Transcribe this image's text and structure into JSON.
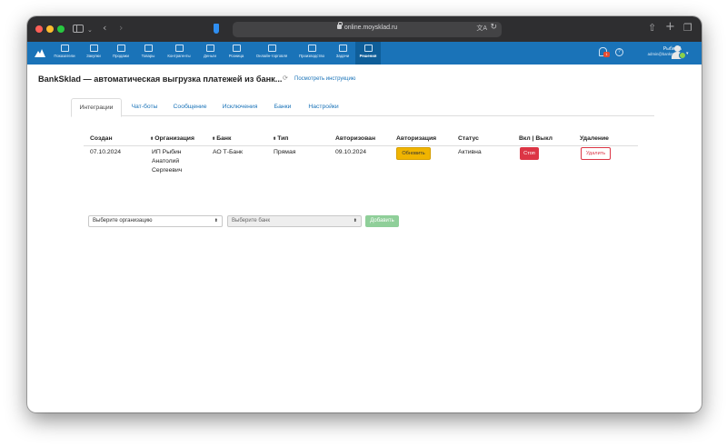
{
  "browser": {
    "url": "online.moysklad.ru",
    "translate_label": "文A",
    "icons": [
      "sidebar-icon",
      "back-icon",
      "forward-icon",
      "share-icon",
      "new-tab-icon",
      "tabs-icon"
    ]
  },
  "nav": {
    "items": [
      {
        "label": "Показатели",
        "icon": "chart-icon"
      },
      {
        "label": "Закупки",
        "icon": "purchases-icon"
      },
      {
        "label": "Продажи",
        "icon": "sales-icon"
      },
      {
        "label": "Товары",
        "icon": "cart-icon"
      },
      {
        "label": "Контрагенты",
        "icon": "contacts-icon"
      },
      {
        "label": "Деньги",
        "icon": "wallet-icon"
      },
      {
        "label": "Розница",
        "icon": "register-icon"
      },
      {
        "label": "Онлайн-торговля",
        "icon": "store-icon"
      },
      {
        "label": "Производство",
        "icon": "factory-icon"
      },
      {
        "label": "Задачи",
        "icon": "tasks-icon"
      },
      {
        "label": "Решения",
        "icon": "solutions-icon"
      }
    ],
    "notifications_count": "1",
    "help_label": "?",
    "user_name": "Рыбин А",
    "user_email": "admin@bankmaker",
    "accent_color": "#1a73b8"
  },
  "page": {
    "title": "BankSklad — автоматическая выгрузка платежей из банк...",
    "instruction_link": "Посмотреть инструкцию"
  },
  "tabs": [
    "Интеграции",
    "Чат-боты",
    "Сообщение",
    "Исключения",
    "Банки",
    "Настройки"
  ],
  "table": {
    "headers": [
      "Создан",
      "Организация",
      "Банк",
      "Тип",
      "Авторизован",
      "Авторизация",
      "Статус",
      "Вкл | Выкл",
      "Удаление"
    ],
    "rows": [
      {
        "created": "07.10.2024",
        "org_line1": "ИП Рыбин",
        "org_line2": "Анатолий",
        "org_line3": "Сергеевич",
        "bank": "АО Т-Банк",
        "type": "Прямая",
        "authorized": "09.10.2024",
        "auth_button": "Обновить",
        "status": "Активна",
        "toggle_button": "Стоп",
        "delete_button": "Удалить"
      }
    ]
  },
  "form": {
    "org_select": "Выберите организацию",
    "bank_select": "Выберите банк",
    "add_button": "Добавить"
  }
}
